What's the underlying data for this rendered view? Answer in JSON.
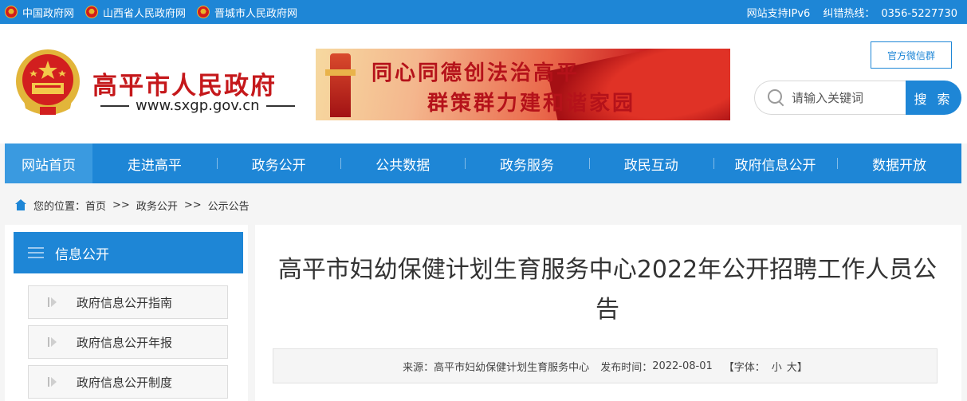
{
  "topbar": {
    "links": [
      "中国政府网",
      "山西省人民政府网",
      "晋城市人民政府网"
    ],
    "ipv6": "网站支持IPv6",
    "hotline_label": "纠错热线：",
    "hotline_number": "0356-5227730"
  },
  "header": {
    "site_title": "高平市人民政府",
    "site_url": "www.sxgp.gov.cn",
    "banner_line1": "同心同德创法治高平",
    "banner_line2": "群策群力建和谐家园",
    "wechat_label": "官方微信群",
    "search_placeholder": "请输入关键词",
    "search_button": "搜 索"
  },
  "nav": {
    "items": [
      "网站首页",
      "走进高平",
      "政务公开",
      "公共数据",
      "政务服务",
      "政民互动",
      "政府信息公开",
      "数据开放"
    ],
    "active": 0
  },
  "breadcrumb": {
    "prefix": "您的位置：",
    "items": [
      "首页",
      "政务公开",
      "公示公告"
    ],
    "separator": ">>"
  },
  "sidebar": {
    "title": "信息公开",
    "items": [
      "政府信息公开指南",
      "政府信息公开年报",
      "政府信息公开制度"
    ]
  },
  "article": {
    "title": "高平市妇幼保健计划生育服务中心2022年公开招聘工作人员公告",
    "source_label": "来源：",
    "source": "高平市妇幼保健计划生育服务中心",
    "date_label": "发布时间：",
    "date": "2022-08-01",
    "font_label": "【字体：",
    "font_small": "小",
    "font_large": "大",
    "font_close": "】"
  },
  "colors": {
    "primary": "#1e86d6",
    "title_red": "#c5181b"
  }
}
